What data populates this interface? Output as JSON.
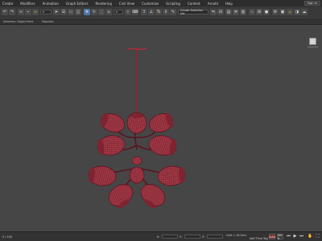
{
  "menubar": {
    "items": [
      "Create",
      "Modifiers",
      "Animation",
      "Graph Editors",
      "Rendering",
      "Civil View",
      "Customize",
      "Scripting",
      "Content",
      "Arnold",
      "Help"
    ],
    "sign_in": "Sign In"
  },
  "toolbar": {
    "selection_set": "Create Selection Set",
    "icons": [
      "undo-icon",
      "redo-icon",
      "link-icon",
      "unlink-icon",
      "bind-space-warp-icon",
      "selection-filter-icon",
      "select-object-icon",
      "select-by-name-icon",
      "rectangular-selection-icon",
      "window-crossing-icon",
      "select-and-move-icon",
      "select-and-rotate-icon",
      "select-and-scale-icon",
      "select-and-place-icon",
      "reference-coordinate-icon",
      "pivot-icon",
      "keyboard-shortcut-override-icon",
      "snaps-toggle-icon",
      "angle-snap-icon",
      "percent-snap-icon",
      "spinner-snap-icon",
      "named-selection-sets-icon",
      "mirror-icon",
      "align-icon",
      "toggle-scene-explorer-icon",
      "toggle-layer-explorer-icon",
      "toggle-ribbon-icon",
      "curve-editor-icon",
      "schematic-view-icon",
      "material-editor-icon",
      "render-setup-icon",
      "rendered-frame-window-icon",
      "render-production-icon",
      "render-iterative-icon",
      "render-in-cloud-icon"
    ]
  },
  "ribbon": {
    "labels": [
      "Selection",
      "Object Paint",
      "Populate"
    ]
  },
  "viewport": {
    "object_color": "#a83a48",
    "wire_color": "#3d0f16",
    "background": "#464646",
    "model": "chandelier"
  },
  "statusbar": {
    "frame_counter": "0 / 100",
    "coord_x": "X:",
    "coord_y": "Y:",
    "coord_z": "Z:",
    "grid_label": "Grid = 10.0cm",
    "add_time_tag": "Add Time Tag",
    "auto_key": "Auto",
    "set_key": "Set K."
  }
}
